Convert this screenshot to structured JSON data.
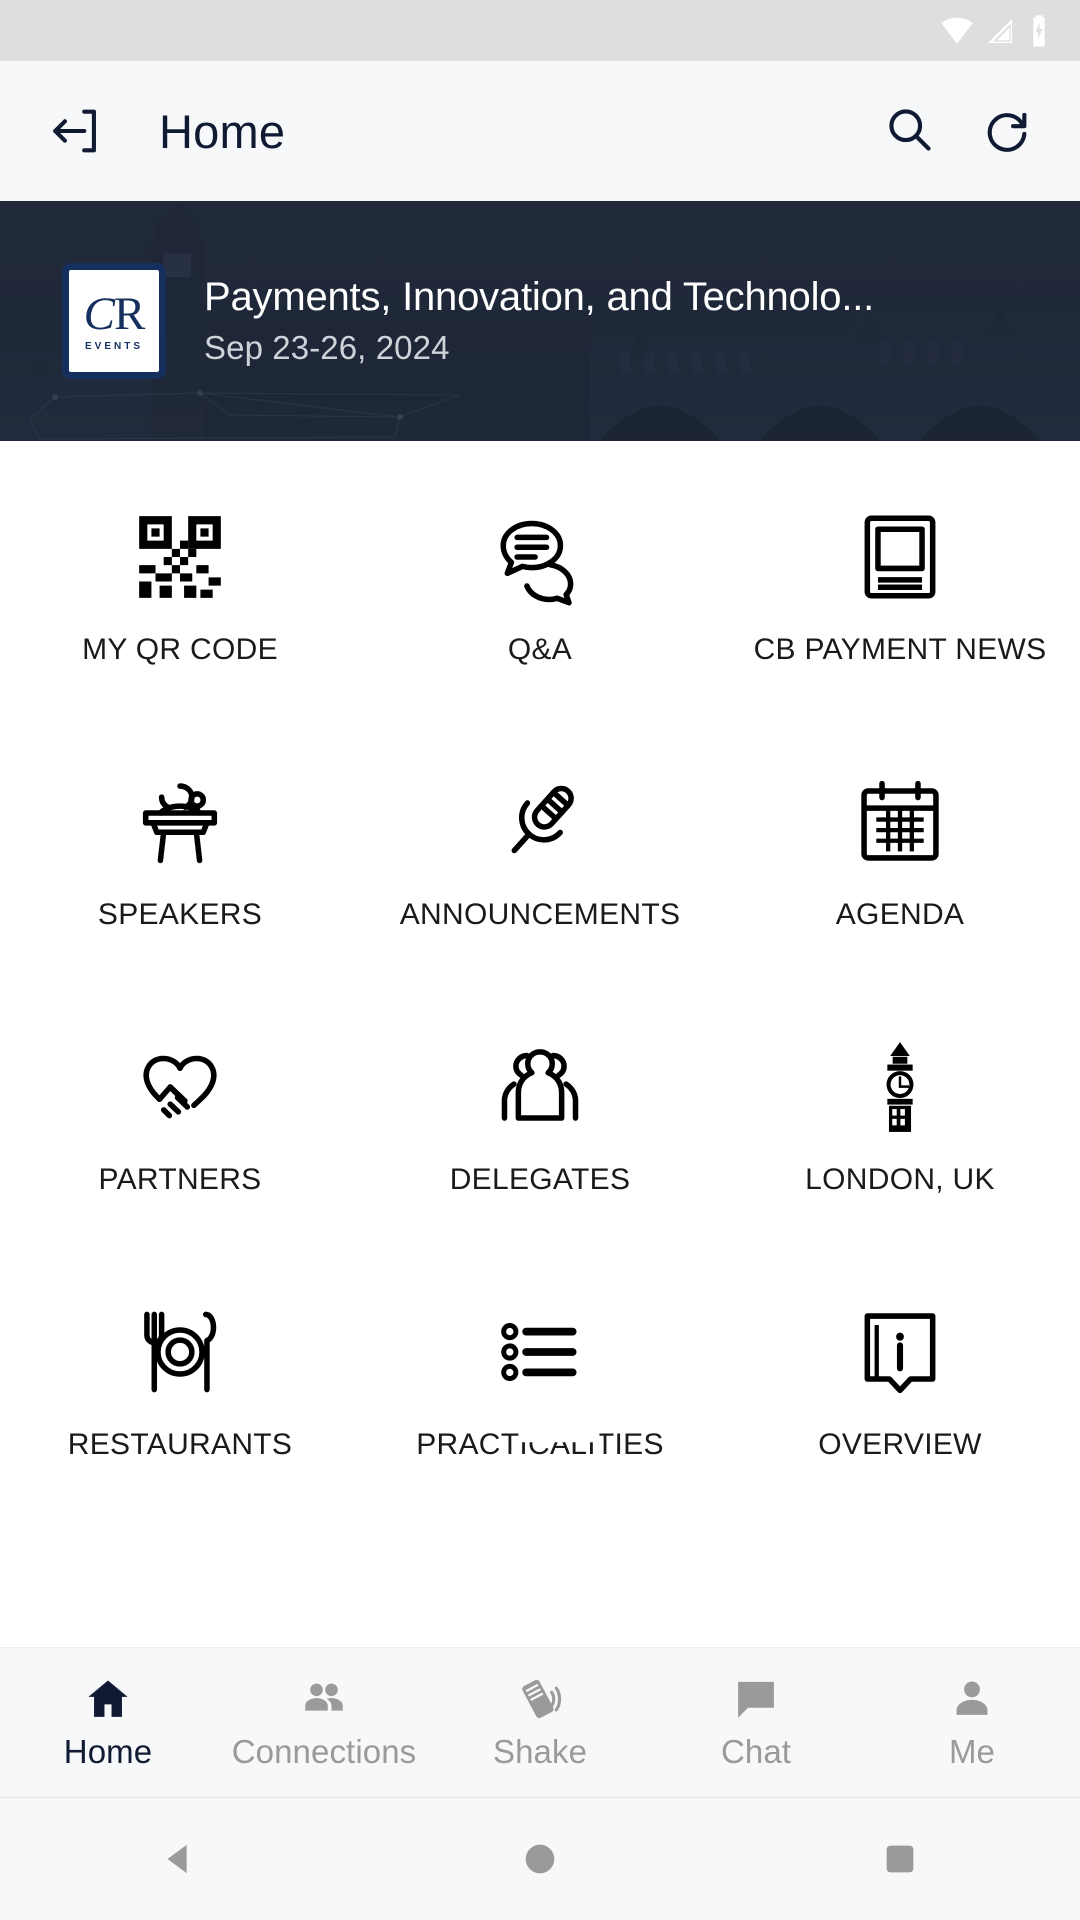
{
  "status_bar": {
    "icons": [
      "wifi-icon",
      "cellular-signal-icon",
      "battery-charging-icon"
    ],
    "background_color": "#dededf",
    "icon_color": "#ffffff"
  },
  "app_bar": {
    "back_icon": "exit-to-app-icon",
    "title": "Home",
    "actions": [
      {
        "icon": "search-icon",
        "name": "search-button"
      },
      {
        "icon": "refresh-icon",
        "name": "refresh-button"
      }
    ],
    "background_color": "#f7f8f9",
    "title_color": "#101b33"
  },
  "banner": {
    "logo": {
      "monogram_c": "C",
      "monogram_r": "R",
      "sub": "EVENTS",
      "color": "#16305e"
    },
    "event_title": "Payments, Innovation, and Technolo...",
    "event_dates": "Sep 23-26, 2024",
    "background_image": "london-skyline-westminster-photo",
    "overlay_color": "#1a2232"
  },
  "grid": {
    "items": [
      {
        "label": "MY QR CODE",
        "icon": "qr-code-icon",
        "name": "grid-item-my-qr-code"
      },
      {
        "label": "Q&A",
        "icon": "chat-bubbles-icon",
        "name": "grid-item-qa"
      },
      {
        "label": "CB PAYMENT NEWS",
        "icon": "book-icon",
        "name": "grid-item-cb-payment-news"
      },
      {
        "label": "SPEAKERS",
        "icon": "lectern-icon",
        "name": "grid-item-speakers"
      },
      {
        "label": "ANNOUNCEMENTS",
        "icon": "microphone-icon",
        "name": "grid-item-announcements"
      },
      {
        "label": "AGENDA",
        "icon": "calendar-icon",
        "name": "grid-item-agenda"
      },
      {
        "label": "PARTNERS",
        "icon": "handshake-heart-icon",
        "name": "grid-item-partners"
      },
      {
        "label": "DELEGATES",
        "icon": "people-group-icon",
        "name": "grid-item-delegates"
      },
      {
        "label": "LONDON, UK",
        "icon": "big-ben-icon",
        "name": "grid-item-london-uk"
      },
      {
        "label": "RESTAURANTS",
        "icon": "cutlery-plate-icon",
        "name": "grid-item-restaurants"
      },
      {
        "label": "PRACTICALITIES",
        "icon": "bullet-list-icon",
        "name": "grid-item-practicalities"
      },
      {
        "label": "OVERVIEW",
        "icon": "info-card-icon",
        "name": "grid-item-overview"
      }
    ],
    "label_color": "#1a1a1a",
    "icon_color": "#000000"
  },
  "tab_bar": {
    "items": [
      {
        "label": "Home",
        "icon": "home-icon",
        "active": true,
        "name": "tab-home"
      },
      {
        "label": "Connections",
        "icon": "people-icon",
        "active": false,
        "name": "tab-connections"
      },
      {
        "label": "Shake",
        "icon": "shake-phone-icon",
        "active": false,
        "name": "tab-shake"
      },
      {
        "label": "Chat",
        "icon": "chat-icon",
        "active": false,
        "name": "tab-chat"
      },
      {
        "label": "Me",
        "icon": "person-icon",
        "active": false,
        "name": "tab-me"
      }
    ],
    "active_color": "#101b33",
    "inactive_color": "#9a9a9d"
  },
  "system_nav": {
    "keys": [
      "back-triangle-icon",
      "home-circle-icon",
      "recents-square-icon"
    ],
    "color": "#9a9a9d"
  }
}
